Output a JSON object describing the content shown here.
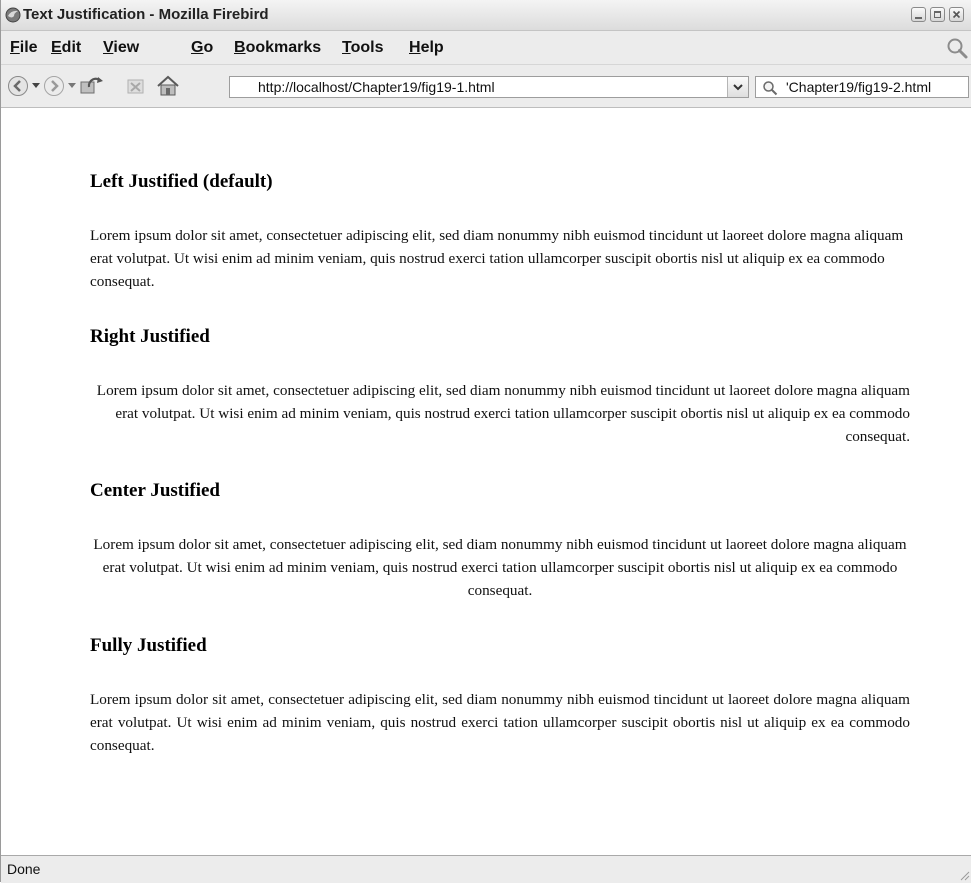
{
  "window": {
    "title": "Text Justification - Mozilla Firebird"
  },
  "menu": {
    "items": [
      {
        "label": "File",
        "key": "F",
        "rest": "ile"
      },
      {
        "label": "Edit",
        "key": "E",
        "rest": "dit"
      },
      {
        "label": "View",
        "key": "V",
        "rest": "iew"
      },
      {
        "label": "Go",
        "key": "G",
        "rest": "o"
      },
      {
        "label": "Bookmarks",
        "key": "B",
        "rest": "ookmarks"
      },
      {
        "label": "Tools",
        "key": "T",
        "rest": "ools"
      },
      {
        "label": "Help",
        "key": "H",
        "rest": "elp"
      }
    ]
  },
  "navigation": {
    "url": "http://localhost/Chapter19/fig19-1.html",
    "search_value": "'Chapter19/fig19-2.html"
  },
  "content": {
    "sections": [
      {
        "heading": "Left Justified (default)",
        "text": "Lorem ipsum dolor sit amet, consectetuer adipiscing elit, sed diam nonummy nibh euismod tincidunt ut laoreet dolore magna aliquam erat volutpat. Ut wisi enim ad minim veniam, quis nostrud exerci tation ullamcorper suscipit obortis nisl ut aliquip ex ea commodo consequat."
      },
      {
        "heading": "Right Justified",
        "text": "Lorem ipsum dolor sit amet, consectetuer adipiscing elit, sed diam nonummy nibh euismod tincidunt ut laoreet dolore magna aliquam erat volutpat. Ut wisi enim ad minim veniam, quis nostrud exerci tation ullamcorper suscipit obortis nisl ut aliquip ex ea commodo consequat."
      },
      {
        "heading": "Center Justified",
        "text": "Lorem ipsum dolor sit amet, consectetuer adipiscing elit, sed diam nonummy nibh euismod tincidunt ut laoreet dolore magna aliquam erat volutpat. Ut wisi enim ad minim veniam, quis nostrud exerci tation ullamcorper suscipit obortis nisl ut aliquip ex ea commodo consequat."
      },
      {
        "heading": "Fully Justified",
        "text": "Lorem ipsum dolor sit amet, consectetuer adipiscing elit, sed diam nonummy nibh euismod tincidunt ut laoreet dolore magna aliquam erat volutpat. Ut wisi enim ad minim veniam, quis nostrud exerci tation ullamcorper suscipit obortis nisl ut aliquip ex ea commodo consequat."
      }
    ]
  },
  "status": {
    "text": "Done"
  },
  "icons": {
    "app": "firebird-app-icon",
    "back": "back-arrow-icon",
    "forward": "forward-arrow-icon",
    "reload": "reload-icon",
    "stop": "stop-icon",
    "home": "home-icon",
    "search": "search-icon",
    "throbber": "throbber-icon"
  }
}
